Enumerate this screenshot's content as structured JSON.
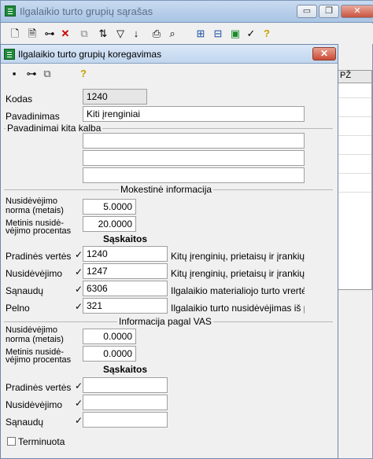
{
  "back_window": {
    "title": "Ilgalaikio turto grupių sąrašas",
    "min_label": "▭",
    "max_label": "❐",
    "close_label": "✕",
    "grid_header": "PŽ"
  },
  "dialog": {
    "title": "Ilgalaikio turto grupių koregavimas",
    "close_label": "✕",
    "kodas_label": "Kodas",
    "kodas_value": "1240",
    "pavadinimas_label": "Pavadinimas",
    "pavadinimas_value": "Kiti įrenginiai",
    "other_lang_label": "Pavadinimai kita kalba",
    "tax_section_title": "Mokestinė informacija",
    "tax": {
      "norm_label_1": "Nusidėvėjimo",
      "norm_label_2": "norma (metais)",
      "norm_value": "5.0000",
      "annual_label_1": "Metinis nusidė-",
      "annual_label_2": "vėjimo procentas",
      "annual_value": "20.0000",
      "accounts_header": "Sąskaitos",
      "accounts": [
        {
          "label": "Pradinės vertės",
          "check": "✓",
          "value": "1240",
          "desc": "Kitų įrenginių, prietaisų ir įrankių įs"
        },
        {
          "label": "Nusidėvėjimo",
          "check": "✓",
          "value": "1247",
          "desc": "Kitų įrenginių, prietaisų ir įrankių n"
        },
        {
          "label": "Sąnaudų",
          "check": "✓",
          "value": "6306",
          "desc": "Ilgalaikio materialiojo turto vrertės n"
        },
        {
          "label": "Pelno",
          "check": "✓",
          "value": "321",
          "desc": "Ilgalaikio turto nusidėvėjimas iš pe"
        }
      ]
    },
    "vas_section_title": "Informacija pagal VAS",
    "vas": {
      "norm_label_1": "Nusidėvėjimo",
      "norm_label_2": "norma (metais)",
      "norm_value": "0.0000",
      "annual_label_1": "Metinis nusidė-",
      "annual_label_2": "vėjimo procentas",
      "annual_value": "0.0000",
      "accounts_header": "Sąskaitos",
      "accounts": [
        {
          "label": "Pradinės vertės",
          "check": "✓",
          "value": ""
        },
        {
          "label": "Nusidėvėjimo",
          "check": "✓",
          "value": ""
        },
        {
          "label": "Sąnaudų",
          "check": "✓",
          "value": ""
        }
      ]
    },
    "terminuota_label": "Terminuota"
  }
}
